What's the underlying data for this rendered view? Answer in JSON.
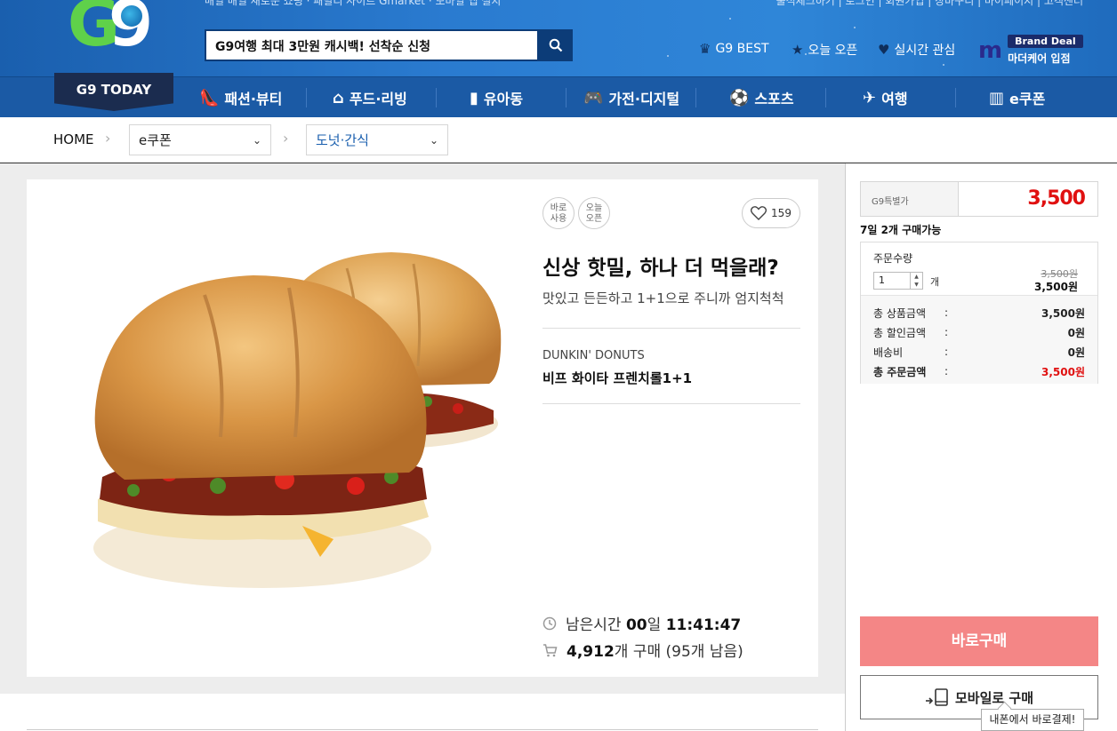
{
  "header": {
    "top_links": "매일 매일 새로운 쇼핑  ·  패밀리 사이트 Gmarket  ·  모바일 앱 설치",
    "top_util": "출석체크하기  |  로그인  |  회원가입  |  장바구니  |  마이페이지  |  고객센터",
    "search_value": "G9여행 최대 3만원 캐시백! 선착순 신청",
    "quick": [
      {
        "label": "G9 BEST",
        "icon": "crown-icon"
      },
      {
        "label": "오늘 오픈",
        "icon": "star-icon"
      },
      {
        "label": "실시간 관심",
        "icon": "heart-icon"
      }
    ],
    "brand_deal_tag": "Brand Deal",
    "brand_deal_sub": "마더케어 입점",
    "brand_deal_logo": "m"
  },
  "nav": {
    "today": "G9 TODAY",
    "items": [
      {
        "label": "패션·뷰티",
        "icon": "shoe-icon"
      },
      {
        "label": "푸드·리빙",
        "icon": "house-icon"
      },
      {
        "label": "유아동",
        "icon": "bottle-icon"
      },
      {
        "label": "가전·디지털",
        "icon": "gamepad-icon"
      },
      {
        "label": "스포츠",
        "icon": "ball-icon"
      },
      {
        "label": "여행",
        "icon": "plane-icon"
      },
      {
        "label": "e쿠폰",
        "icon": "barcode-icon"
      }
    ]
  },
  "breadcrumb": {
    "home": "HOME",
    "level1": "e쿠폰",
    "level2": "도넛·간식"
  },
  "product": {
    "badges": [
      {
        "line1": "바로",
        "line2": "사용"
      },
      {
        "line1": "오늘",
        "line2": "오픈"
      }
    ],
    "likes": "159",
    "title": "신상 핫밀, 하나 더 먹을래?",
    "subtitle": "맛있고 든든하고 1+1으로 주니까 엄지척척",
    "brand": "DUNKIN' DONUTS",
    "name": "비프 화이타 프렌치롤1+1",
    "timer_label": "남은시간",
    "timer_days": "00",
    "timer_days_unit": "일",
    "timer_time": "11:41:47",
    "sold_count": "4,912",
    "sold_suffix": "개 구매 (95개 남음)"
  },
  "order": {
    "price_label": "G9특별가",
    "price": "3,500",
    "limit": "7일 2개 구매가능",
    "qty_label": "주문수량",
    "qty_value": "1",
    "qty_unit": "개",
    "orig_price": "3,500원",
    "cur_price": "3,500원",
    "rows": [
      {
        "k": "총 상품금액",
        "c": ":",
        "v": "3,500원"
      },
      {
        "k": "총 할인금액",
        "c": ":",
        "v": "0원"
      },
      {
        "k": "배송비",
        "c": ":",
        "v": "0원"
      },
      {
        "k": "총 주문금액",
        "c": ":",
        "v": "3,500원"
      }
    ],
    "buy_label": "바로구매",
    "mobile_label": "모바일로 구매",
    "tooltip": "내폰에서 바로결제!"
  },
  "colors": {
    "header_blue": "#2a7bd0",
    "nav_blue": "#1b5aa5",
    "price_red": "#e01010",
    "buy_pink": "#f48686"
  }
}
